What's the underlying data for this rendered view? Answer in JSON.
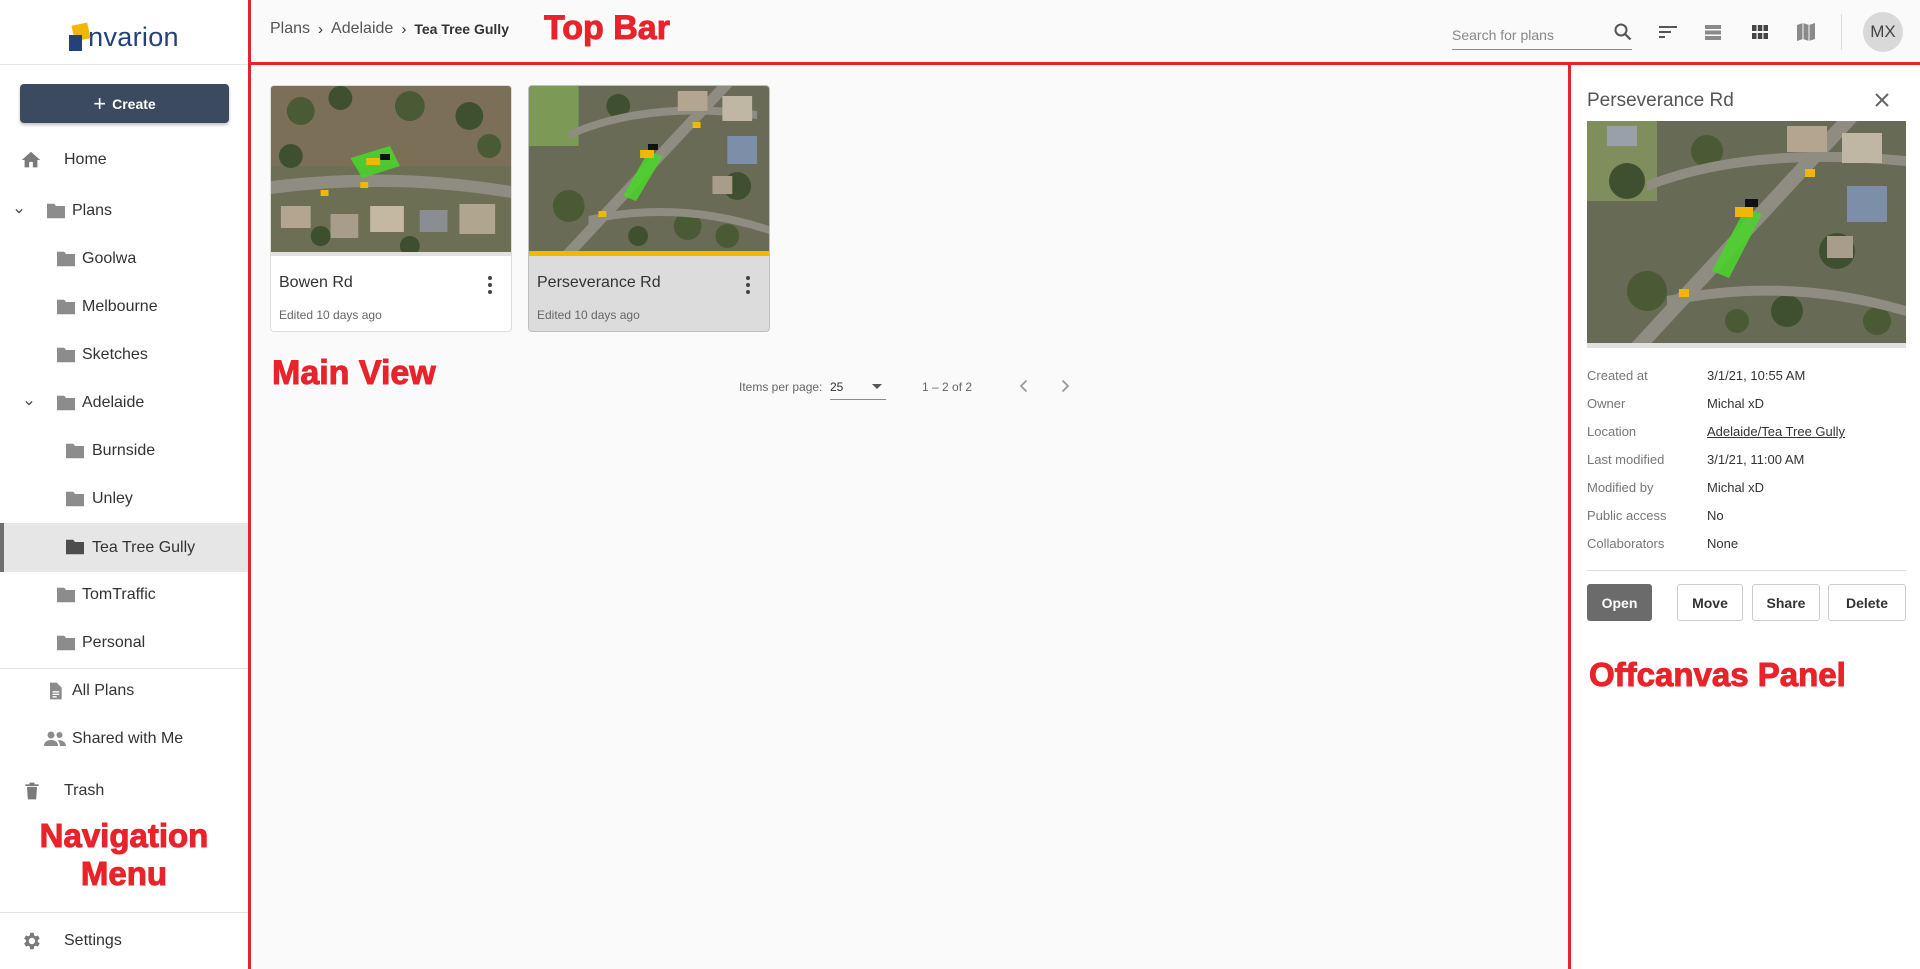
{
  "app": {
    "logo_text": "nvarion"
  },
  "sidebar": {
    "create_label": "Create",
    "home": "Home",
    "plans": "Plans",
    "folders": {
      "goolwa": "Goolwa",
      "melbourne": "Melbourne",
      "sketches": "Sketches",
      "adelaide": "Adelaide",
      "burnside": "Burnside",
      "unley": "Unley",
      "tea_tree_gully": "Tea Tree Gully",
      "tomtraffic": "TomTraffic",
      "personal": "Personal"
    },
    "all_plans": "All Plans",
    "shared_with_me": "Shared with Me",
    "trash": "Trash",
    "settings": "Settings"
  },
  "topbar": {
    "breadcrumb": [
      "Plans",
      "Adelaide",
      "Tea Tree Gully"
    ],
    "search_placeholder": "Search for plans",
    "avatar_initials": "MX"
  },
  "cards": [
    {
      "title": "Bowen Rd",
      "edited": "Edited 10 days ago",
      "selected": false
    },
    {
      "title": "Perseverance Rd",
      "edited": "Edited 10 days ago",
      "selected": true
    }
  ],
  "paginator": {
    "items_per_page_label": "Items per page:",
    "page_size": "25",
    "range": "1 – 2 of 2"
  },
  "panel": {
    "title": "Perseverance Rd",
    "properties": [
      {
        "key": "Created at",
        "value": "3/1/21, 10:55 AM"
      },
      {
        "key": "Owner",
        "value": "Michal xD"
      },
      {
        "key": "Location",
        "value": "Adelaide/Tea Tree Gully"
      },
      {
        "key": "Last modified",
        "value": "3/1/21, 11:00 AM"
      },
      {
        "key": "Modified by",
        "value": "Michal xD"
      },
      {
        "key": "Public access",
        "value": "No"
      },
      {
        "key": "Collaborators",
        "value": "None"
      }
    ],
    "buttons": {
      "open": "Open",
      "move": "Move",
      "share": "Share",
      "delete": "Delete"
    }
  },
  "annotations": {
    "top_bar": "Top Bar",
    "main_view": "Main View",
    "offcanvas_panel": "Offcanvas Panel",
    "navigation_menu_line1": "Navigation",
    "navigation_menu_line2": "Menu"
  },
  "colors": {
    "annotation_red": "#e8232a",
    "create_button": "#3b4a5e",
    "logo_blue": "#25417a",
    "logo_yellow": "#f2b705",
    "selected_card_bar": "#f2b705"
  }
}
